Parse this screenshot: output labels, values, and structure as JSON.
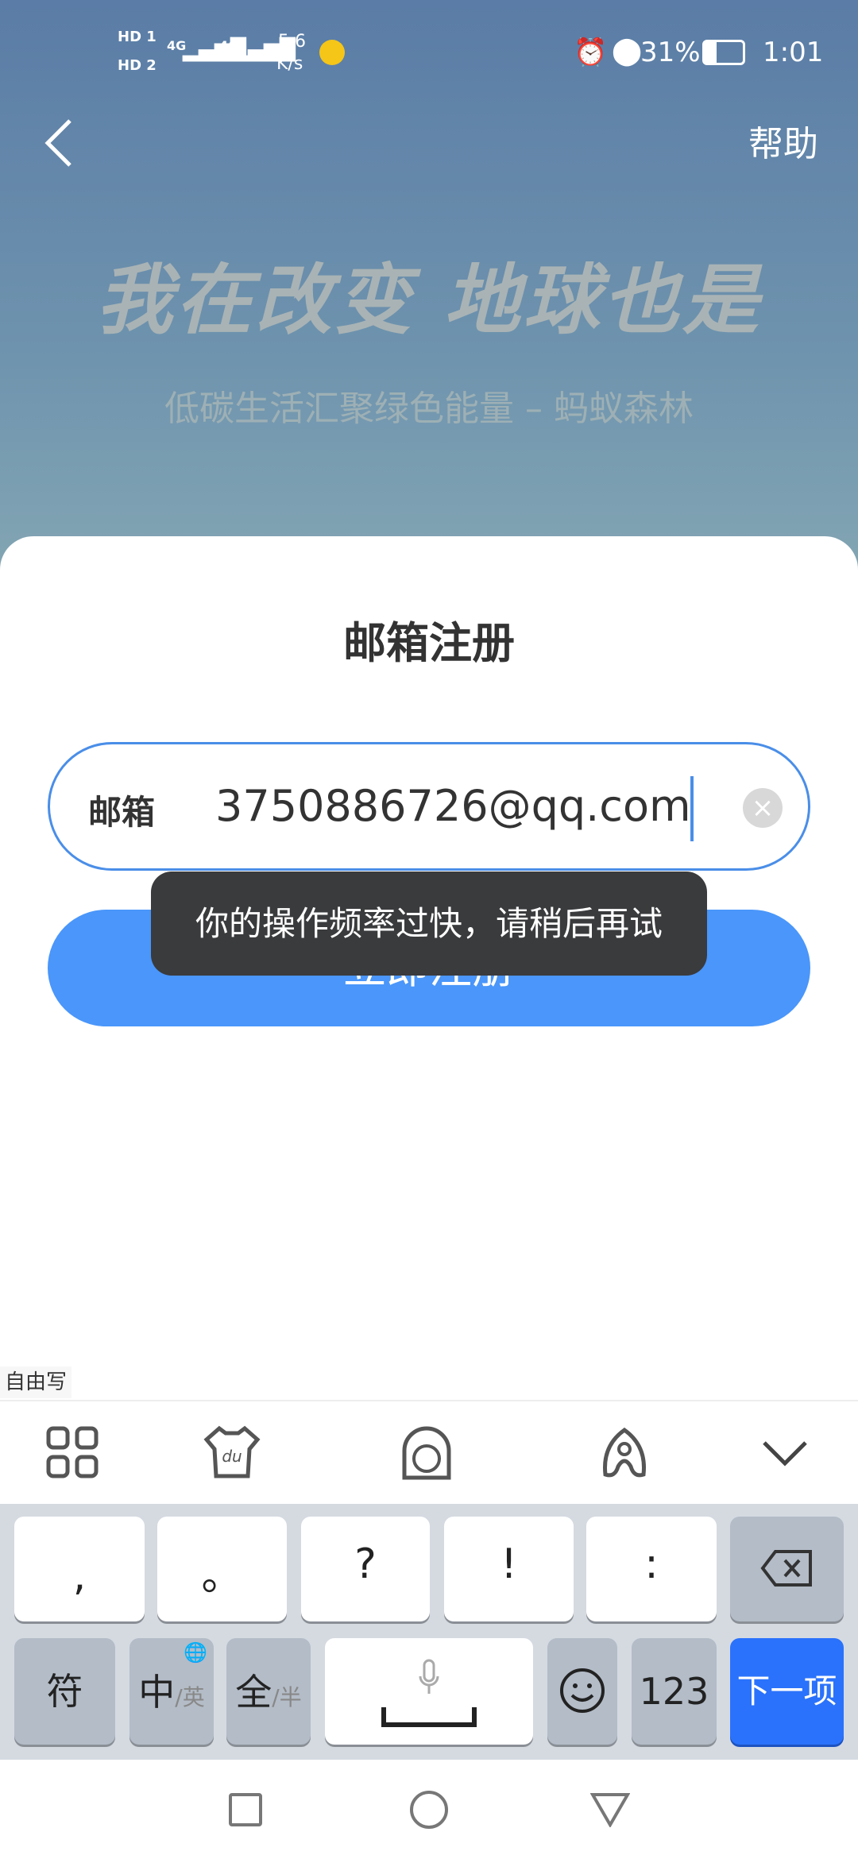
{
  "status_bar": {
    "sim1": "HD 1",
    "sim2": "HD 2",
    "net1": "4G",
    "net2": "4G",
    "speed_value": "5.6",
    "speed_unit": "K/s",
    "battery": "31%",
    "battery_level": 0.31,
    "time": "1:01"
  },
  "header": {
    "back_icon": "chevron-left-icon",
    "help": "帮助"
  },
  "banner": {
    "headline": "我在改变 地球也是",
    "subtitle": "低碳生活汇聚绿色能量 – 蚂蚁森林"
  },
  "form": {
    "title": "邮箱注册",
    "email_label": "邮箱",
    "email_value": "3750886726@qq.com",
    "submit": "立即注册"
  },
  "toast": "你的操作频率过快，请稍后再试",
  "keyboard": {
    "handwriting_tab": "自由写",
    "row1": [
      ",",
      "。",
      "?",
      "!",
      ":"
    ],
    "sym": "符",
    "lang_main": "中",
    "lang_alt": "/英",
    "width_main": "全",
    "width_alt": "/半",
    "num": "123",
    "next": "下一项"
  },
  "colors": {
    "accent": "#4a96fa",
    "next_key": "#2a72fb"
  }
}
